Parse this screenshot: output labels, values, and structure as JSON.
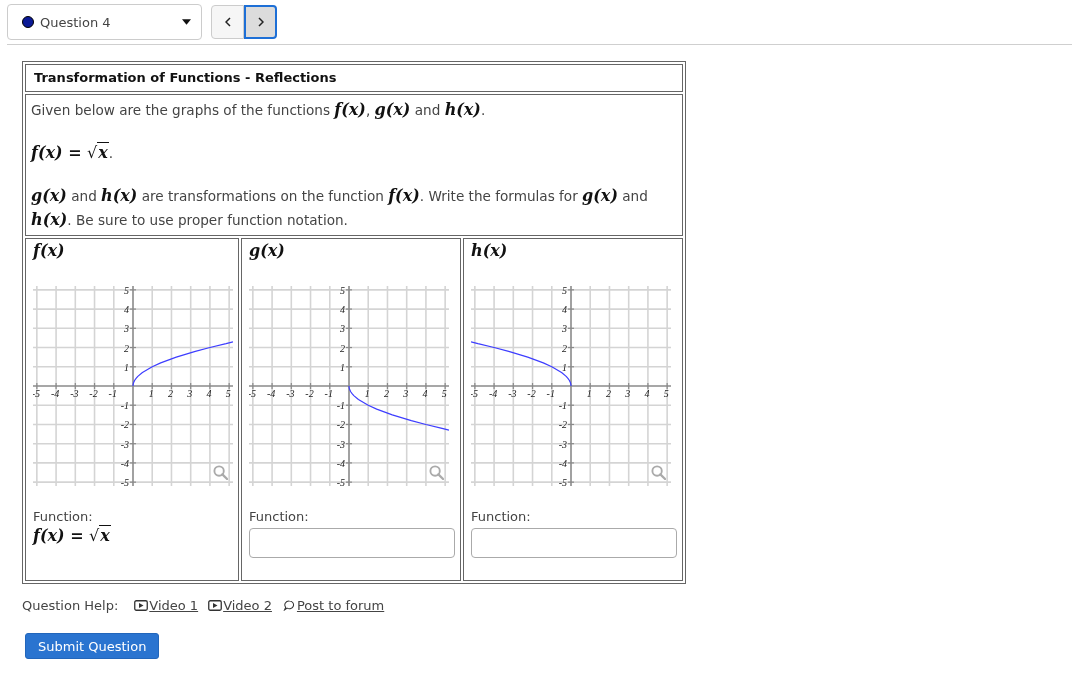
{
  "question_select": {
    "label": "Question 4"
  },
  "nav_buttons": [
    {
      "kind": "previous",
      "focused": false
    },
    {
      "kind": "next",
      "focused": true
    }
  ],
  "question": {
    "title": "Transformation of Functions - Reflections",
    "paragraphs": [
      {
        "kind": "rich",
        "text": "Given below are the graphs of the functions *f(x)*, *g(x)* and *h(x)*."
      },
      {
        "kind": "formula",
        "parts": [
          {
            "kind": "math",
            "text": "f(x) = "
          },
          {
            "kind": "sqrt",
            "sign": "√",
            "radicand": "x"
          },
          {
            "kind": "text",
            "text": "."
          }
        ]
      },
      {
        "kind": "rich",
        "text": "*g(x)* and *h(x)* are transformations on the function *f(x)*. Write the formulas for *g(x)* and *h(x)*. Be sure to use proper function notation."
      }
    ],
    "graphs": [
      {
        "chart_data": {
          "type": "line",
          "title": "f(x)",
          "grid": true,
          "x": [
            0,
            0.01,
            0.04,
            0.09,
            0.16,
            0.25,
            0.49,
            1,
            1.44,
            2.25,
            3.24,
            4,
            4.84,
            5.2
          ],
          "series": [
            {
              "color": "#3d3dff",
              "values": [
                0,
                0.1,
                0.2,
                0.3,
                0.4,
                0.5,
                0.7,
                1,
                1.2,
                1.5,
                1.8,
                2,
                2.2,
                2.3
              ]
            }
          ],
          "xlim": [
            -5.2,
            5.2
          ],
          "ylim": [
            -5.2,
            5.2
          ],
          "xticks": [
            -5,
            -4,
            -3,
            -2,
            -1,
            1,
            2,
            3,
            4,
            5
          ],
          "yticks": [
            -5,
            -4,
            -3,
            -2,
            -1,
            1,
            2,
            3,
            4,
            5
          ]
        },
        "answer_label": "Function:",
        "answer": {
          "kind": "formula",
          "parts": [
            {
              "kind": "math",
              "text": "f(x) = "
            },
            {
              "kind": "sqrt",
              "sign": "√",
              "radicand": "x"
            }
          ]
        }
      },
      {
        "chart_data": {
          "type": "line",
          "title": "g(x)",
          "grid": true,
          "x": [
            0,
            0.01,
            0.04,
            0.09,
            0.16,
            0.25,
            0.49,
            1,
            1.44,
            2.25,
            3.24,
            4,
            4.84,
            5.2
          ],
          "series": [
            {
              "color": "#3d3dff",
              "values": [
                0,
                -0.1,
                -0.2,
                -0.3,
                -0.4,
                -0.5,
                -0.7,
                -1,
                -1.2,
                -1.5,
                -1.8,
                -2,
                -2.2,
                -2.3
              ]
            }
          ],
          "xlim": [
            -5.2,
            5.2
          ],
          "ylim": [
            -5.2,
            5.2
          ],
          "xticks": [
            -5,
            -4,
            -3,
            -2,
            -1,
            1,
            2,
            3,
            4,
            5
          ],
          "yticks": [
            -5,
            -4,
            -3,
            -2,
            -1,
            1,
            2,
            3,
            4,
            5
          ]
        },
        "answer_label": "Function:",
        "answer": {
          "kind": "field"
        }
      },
      {
        "chart_data": {
          "type": "line",
          "title": "h(x)",
          "grid": true,
          "x": [
            -5.2,
            -4.84,
            -4,
            -3.24,
            -2.25,
            -1.44,
            -1,
            -0.49,
            -0.25,
            -0.16,
            -0.09,
            -0.04,
            -0.01,
            0
          ],
          "series": [
            {
              "color": "#3d3dff",
              "values": [
                2.3,
                2.2,
                2,
                1.8,
                1.5,
                1.2,
                1,
                0.7,
                0.5,
                0.4,
                0.3,
                0.2,
                0.1,
                0
              ]
            }
          ],
          "xlim": [
            -5.2,
            5.2
          ],
          "ylim": [
            -5.2,
            5.2
          ],
          "xticks": [
            -5,
            -4,
            -3,
            -2,
            -1,
            1,
            2,
            3,
            4,
            5
          ],
          "yticks": [
            -5,
            -4,
            -3,
            -2,
            -1,
            1,
            2,
            3,
            4,
            5
          ]
        },
        "answer_label": "Function:",
        "answer": {
          "kind": "field"
        }
      }
    ]
  },
  "help": {
    "label": "Question Help:",
    "links": [
      {
        "kind": "video",
        "label": "Video 1"
      },
      {
        "kind": "video",
        "label": "Video 2"
      },
      {
        "kind": "forum",
        "label": "Post to forum"
      }
    ]
  },
  "submit_button": "Submit Question"
}
